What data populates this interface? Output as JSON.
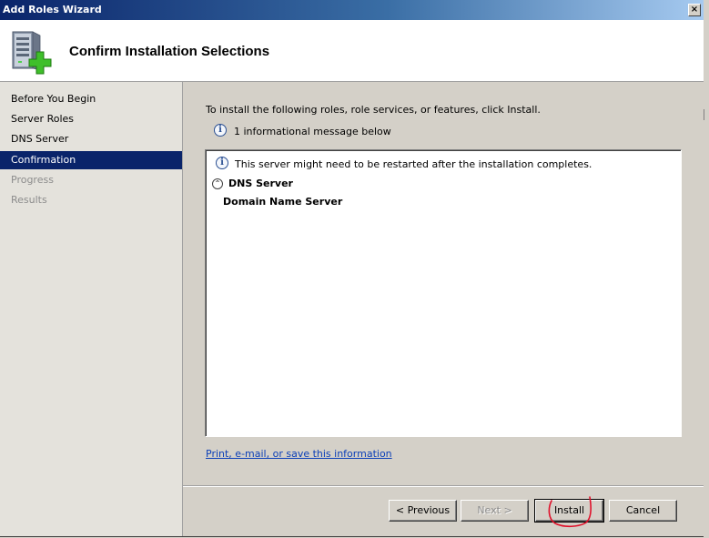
{
  "window": {
    "title": "Add Roles Wizard",
    "close_glyph": "×"
  },
  "header": {
    "title": "Confirm Installation Selections",
    "icon": "server-add-icon"
  },
  "sidebar": {
    "items": [
      {
        "label": "Before You Begin",
        "state": "normal"
      },
      {
        "label": "Server Roles",
        "state": "normal"
      },
      {
        "label": "DNS Server",
        "state": "normal"
      },
      {
        "label": "Confirmation",
        "state": "active"
      },
      {
        "label": "Progress",
        "state": "disabled"
      },
      {
        "label": "Results",
        "state": "disabled"
      }
    ]
  },
  "content": {
    "instruction": "To install the following roles, role services, or features, click Install.",
    "info_message": "1 informational message below",
    "details": {
      "restart_message": "This server might need to be restarted after the installation completes.",
      "role_name": "DNS Server",
      "role_service": "Domain Name Server"
    },
    "print_link": "Print, e-mail, or save this information"
  },
  "buttons": {
    "previous": "< Previous",
    "next": "Next >",
    "install": "Install",
    "cancel": "Cancel"
  },
  "colors": {
    "selection": "#0a246a",
    "link": "#0b3fb8",
    "annotation": "#e0102a"
  }
}
